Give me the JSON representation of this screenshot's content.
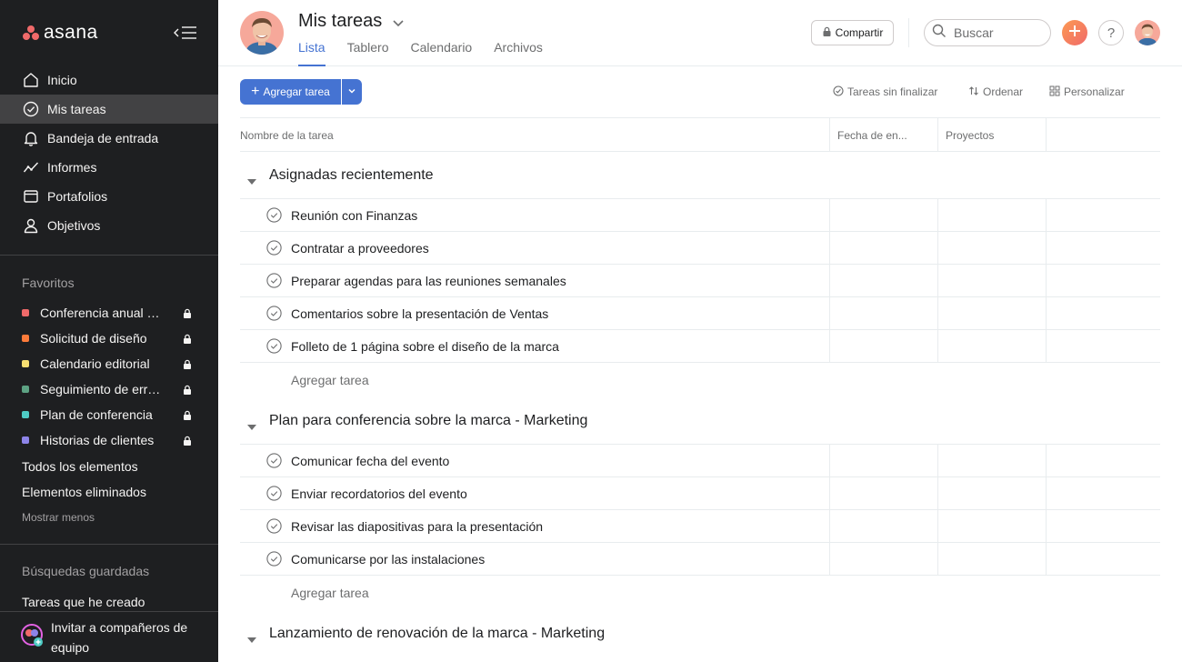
{
  "app": {
    "logo_text": "asana"
  },
  "sidebar": {
    "nav": [
      {
        "label": "Inicio",
        "icon": "home-icon"
      },
      {
        "label": "Mis tareas",
        "icon": "check-circle-icon",
        "active": true
      },
      {
        "label": "Bandeja de entrada",
        "icon": "bell-icon"
      },
      {
        "label": "Informes",
        "icon": "chart-line-icon"
      },
      {
        "label": "Portafolios",
        "icon": "folder-icon"
      },
      {
        "label": "Objetivos",
        "icon": "person-icon"
      }
    ],
    "favorites_title": "Favoritos",
    "favorites": [
      {
        "label": "Conferencia anual de ventas",
        "color": "#f06a6a"
      },
      {
        "label": "Solicitud de diseño",
        "color": "#fd7b3a"
      },
      {
        "label": "Calendario editorial",
        "color": "#f8df72"
      },
      {
        "label": "Seguimiento de errores",
        "color": "#5da283"
      },
      {
        "label": "Plan de conferencia",
        "color": "#4ecbc4"
      },
      {
        "label": "Historias de clientes",
        "color": "#8d84e8"
      }
    ],
    "all_items": "Todos los elementos",
    "deleted_items": "Elementos eliminados",
    "show_less": "Mostrar menos",
    "saved_searches_title": "Búsquedas guardadas",
    "saved_search_1": "Tareas que he creado",
    "invite_label": "Invitar a compañeros de equipo"
  },
  "header": {
    "title": "Mis tareas",
    "tabs": [
      "Lista",
      "Tablero",
      "Calendario",
      "Archivos"
    ],
    "share_label": "Compartir",
    "search_placeholder": "Buscar",
    "help_label": "?"
  },
  "toolbar": {
    "add_task_label": "Agregar tarea",
    "filter_label": "Tareas sin finalizar",
    "sort_label": "Ordenar",
    "customize_label": "Personalizar"
  },
  "table": {
    "columns": [
      "Nombre de la tarea",
      "Fecha de en...",
      "Proyectos"
    ],
    "add_task_label": "Agregar tarea",
    "groups": [
      {
        "title": "Asignadas recientemente",
        "tasks": [
          "Reunión con Finanzas",
          "Contratar a proveedores",
          "Preparar agendas para las reuniones semanales",
          "Comentarios sobre la presentación de Ventas",
          "Folleto de 1 página sobre el diseño de la marca"
        ]
      },
      {
        "title": "Plan para conferencia sobre la marca - Marketing",
        "tasks": [
          "Comunicar fecha del evento",
          "Enviar recordatorios del evento",
          "Revisar las diapositivas para la presentación",
          "Comunicarse por las instalaciones"
        ]
      },
      {
        "title": "Lanzamiento de renovación de la marca - Marketing",
        "tasks": []
      }
    ]
  }
}
